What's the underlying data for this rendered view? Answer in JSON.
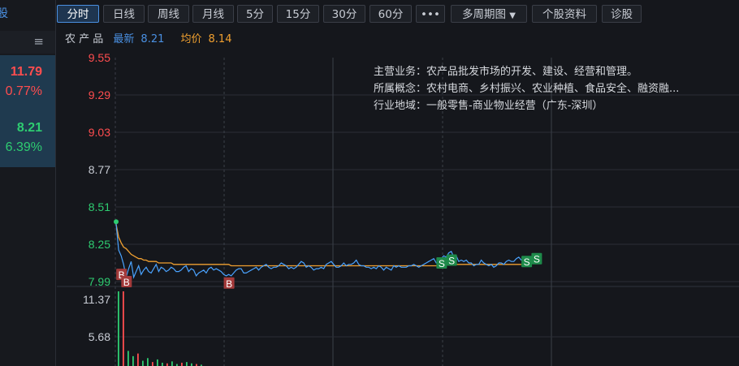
{
  "left_panel": {
    "top_text": "股",
    "menu_icon": "hamburger-icon",
    "items": [
      {
        "value": "11.79",
        "change": "0.77%",
        "color": "#ff4d4f"
      },
      {
        "value": "8.21",
        "change": "6.39%",
        "color": "#2ecc71"
      }
    ]
  },
  "toolbar": {
    "buttons": [
      {
        "label": "分时",
        "active": true
      },
      {
        "label": "日线"
      },
      {
        "label": "周线"
      },
      {
        "label": "月线"
      },
      {
        "label": "5分"
      },
      {
        "label": "15分"
      },
      {
        "label": "30分"
      },
      {
        "label": "60分"
      },
      {
        "label": "•••",
        "icon": "more-icon"
      },
      {
        "label": "多周期图",
        "dropdown": true
      },
      {
        "label": "个股资料"
      },
      {
        "label": "诊股"
      }
    ]
  },
  "info": {
    "stock_name": "农 产 品",
    "latest_label": "最新",
    "latest": "8.21",
    "avg_label": "均价",
    "avg": "8.14",
    "latest_color": "#4a90e2",
    "avg_color": "#f0a030"
  },
  "description": {
    "main_business": "主营业务：农产品批发市场的开发、建设、经营和管理。",
    "concepts": "所属概念：农村电商、乡村振兴、农业种植、食品安全、融资融...",
    "industry": "行业地域：一般零售-商业物业经营（广东-深圳）"
  },
  "chart_data": {
    "type": "line",
    "price_ticks": [
      "9.55",
      "9.29",
      "9.03",
      "8.77",
      "8.51",
      "8.25",
      "7.99"
    ],
    "price_tick_colors": [
      "#ff4d4f",
      "#ff4d4f",
      "#ff4d4f",
      "#c8ccd4",
      "#2ecc71",
      "#2ecc71",
      "#2ecc71"
    ],
    "volume_ticks": [
      "11.37",
      "5.68"
    ],
    "ylim": [
      7.99,
      9.55
    ],
    "price": [
      8.39,
      8.21,
      8.17,
      8.11,
      8.02,
      8.08,
      8.13,
      8.02,
      8.06,
      8.1,
      8.04,
      8.07,
      8.09,
      8.06,
      8.05,
      8.08,
      8.11,
      8.06,
      8.09,
      8.08,
      8.06,
      8.07,
      8.09,
      8.08,
      8.06,
      8.06,
      8.07,
      8.09,
      8.1,
      8.06,
      8.08,
      8.07,
      8.03,
      8.05,
      8.06,
      8.07,
      8.05,
      8.08,
      8.09,
      8.07,
      8.08,
      8.07,
      8.06,
      8.04,
      8.03,
      8.04,
      8.03,
      8.05,
      8.07,
      8.08,
      8.08,
      8.05,
      8.05,
      8.06,
      8.07,
      8.08,
      8.09,
      8.07,
      8.09,
      8.1,
      8.11,
      8.09,
      8.08,
      8.09,
      8.09,
      8.1,
      8.12,
      8.11,
      8.1,
      8.08,
      8.09,
      8.08,
      8.09,
      8.11,
      8.13,
      8.12,
      8.09,
      8.1,
      8.09,
      8.07,
      8.08,
      8.08,
      8.09,
      8.08,
      8.11,
      8.12,
      8.13,
      8.11,
      8.09,
      8.09,
      8.1,
      8.12,
      8.1,
      8.11,
      8.11,
      8.12,
      8.14,
      8.11,
      8.1,
      8.1,
      8.09,
      8.09,
      8.08,
      8.09,
      8.08,
      8.1,
      8.09,
      8.07,
      8.09,
      8.08,
      8.07,
      8.1,
      8.09,
      8.1,
      8.09,
      8.09,
      8.09,
      8.1,
      8.1,
      8.11,
      8.1,
      8.09,
      8.1,
      8.11,
      8.12,
      8.13,
      8.14,
      8.15,
      8.12,
      8.12,
      8.15,
      8.17,
      8.16,
      8.19,
      8.2,
      8.16,
      8.17,
      8.13,
      8.14,
      8.13,
      8.14,
      8.12,
      8.12,
      8.1,
      8.11,
      8.11,
      8.14,
      8.12,
      8.11,
      8.1,
      8.11,
      8.09,
      8.1,
      8.12,
      8.12,
      8.11,
      8.13,
      8.14,
      8.13,
      8.13,
      8.15,
      8.16,
      8.14,
      8.15
    ],
    "avg": [
      8.39,
      8.3,
      8.26,
      8.23,
      8.22,
      8.2,
      8.18,
      8.17,
      8.16,
      8.15,
      8.15,
      8.14,
      8.14,
      8.13,
      8.13,
      8.13,
      8.13,
      8.12,
      8.12,
      8.12,
      8.12,
      8.12,
      8.12,
      8.11,
      8.11,
      8.11,
      8.11,
      8.11,
      8.11,
      8.11,
      8.11,
      8.11,
      8.11,
      8.11,
      8.11,
      8.11,
      8.11,
      8.11,
      8.11,
      8.11,
      8.11,
      8.11,
      8.11,
      8.11,
      8.11,
      8.11,
      8.1,
      8.1,
      8.1,
      8.1,
      8.1,
      8.1,
      8.1,
      8.1,
      8.1,
      8.1,
      8.1,
      8.1,
      8.1,
      8.1,
      8.1,
      8.1,
      8.1,
      8.1,
      8.1,
      8.1,
      8.1,
      8.1,
      8.1,
      8.1,
      8.1,
      8.1,
      8.1,
      8.1,
      8.1,
      8.1,
      8.1,
      8.1,
      8.1,
      8.1,
      8.1,
      8.1,
      8.1,
      8.1,
      8.1,
      8.1,
      8.1,
      8.1,
      8.1,
      8.1,
      8.1,
      8.1,
      8.1,
      8.1,
      8.1,
      8.1,
      8.1,
      8.1,
      8.1,
      8.1,
      8.1,
      8.1,
      8.1,
      8.1,
      8.1,
      8.1,
      8.1,
      8.1,
      8.1,
      8.1,
      8.1,
      8.1,
      8.1,
      8.1,
      8.1,
      8.1,
      8.1,
      8.1,
      8.1,
      8.1,
      8.1,
      8.1,
      8.1,
      8.1,
      8.1,
      8.1,
      8.1,
      8.1,
      8.1,
      8.1,
      8.11,
      8.11,
      8.11,
      8.11,
      8.11,
      8.11,
      8.11,
      8.11,
      8.11,
      8.11,
      8.11,
      8.11,
      8.11,
      8.11,
      8.11,
      8.11,
      8.11,
      8.11,
      8.11,
      8.11,
      8.11,
      8.11,
      8.11,
      8.11,
      8.11,
      8.11,
      8.11,
      8.11,
      8.11,
      8.11,
      8.11,
      8.11,
      8.11
    ],
    "volumes": [
      11.37,
      11.37,
      2.3,
      1.5,
      1.9,
      0.8,
      1.2,
      0.6,
      1.0,
      0.5,
      0.4,
      0.7,
      0.3,
      0.5,
      0.6,
      0.4,
      0.3,
      0.2
    ],
    "markers": [
      {
        "label": "B",
        "idx": 2,
        "price": 8.04
      },
      {
        "label": "B",
        "idx": 4,
        "price": 7.99
      },
      {
        "label": "B",
        "idx": 45,
        "price": 7.98
      },
      {
        "label": "S",
        "idx": 130,
        "price": 8.12
      },
      {
        "label": "S",
        "idx": 134,
        "price": 8.14
      },
      {
        "label": "S",
        "idx": 164,
        "price": 8.13
      },
      {
        "label": "S",
        "idx": 168,
        "price": 8.15
      }
    ],
    "up_color": "#2ecc71",
    "price_color": "#4aa3ff",
    "avg_color": "#f0a030",
    "buy_color": "#a33a3a",
    "sell_color": "#1e8a4a"
  }
}
